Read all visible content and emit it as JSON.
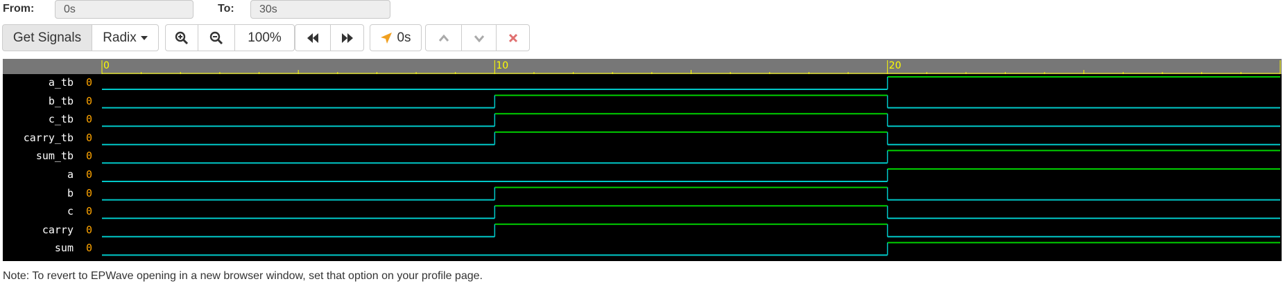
{
  "range": {
    "from_label": "From:",
    "from_value": "0s",
    "to_label": "To:",
    "to_value": "30s"
  },
  "toolbar": {
    "get_signals": "Get Signals",
    "radix": "Radix",
    "zoom": "100%",
    "cursor_time": "0s"
  },
  "icons": {
    "zoom_in": "zoom-in-icon",
    "zoom_out": "zoom-out-icon",
    "rewind": "rewind-icon",
    "fast_forward": "fast-forward-icon",
    "cursor": "location-arrow-icon",
    "up": "chevron-up-icon",
    "down": "chevron-down-icon",
    "close": "close-icon"
  },
  "colors": {
    "ruler_bg": "#777777",
    "ruler_text": "#ffff00",
    "wave_bg": "#000000",
    "low_line": "#00c8c8",
    "high_line": "#00d000",
    "value_text": "#ffa500",
    "name_text": "#ffffff"
  },
  "waveform": {
    "time_start": 0,
    "time_end": 30,
    "major_ticks": [
      "0",
      "10",
      "20"
    ],
    "signals": [
      {
        "name": "a_tb",
        "value": "0",
        "transitions": [
          [
            0,
            0
          ],
          [
            20,
            1
          ]
        ]
      },
      {
        "name": "b_tb",
        "value": "0",
        "transitions": [
          [
            0,
            0
          ],
          [
            10,
            1
          ],
          [
            20,
            0
          ]
        ]
      },
      {
        "name": "c_tb",
        "value": "0",
        "transitions": [
          [
            0,
            0
          ],
          [
            10,
            1
          ],
          [
            20,
            0
          ]
        ]
      },
      {
        "name": "carry_tb",
        "value": "0",
        "transitions": [
          [
            0,
            0
          ],
          [
            10,
            1
          ],
          [
            20,
            0
          ]
        ]
      },
      {
        "name": "sum_tb",
        "value": "0",
        "transitions": [
          [
            0,
            0
          ],
          [
            20,
            1
          ]
        ]
      },
      {
        "name": "a",
        "value": "0",
        "transitions": [
          [
            0,
            0
          ],
          [
            20,
            1
          ]
        ]
      },
      {
        "name": "b",
        "value": "0",
        "transitions": [
          [
            0,
            0
          ],
          [
            10,
            1
          ],
          [
            20,
            0
          ]
        ]
      },
      {
        "name": "c",
        "value": "0",
        "transitions": [
          [
            0,
            0
          ],
          [
            10,
            1
          ],
          [
            20,
            0
          ]
        ]
      },
      {
        "name": "carry",
        "value": "0",
        "transitions": [
          [
            0,
            0
          ],
          [
            10,
            1
          ],
          [
            20,
            0
          ]
        ]
      },
      {
        "name": "sum",
        "value": "0",
        "transitions": [
          [
            0,
            0
          ],
          [
            20,
            1
          ]
        ]
      }
    ]
  },
  "note": "Note: To revert to EPWave opening in a new browser window, set that option on your profile page."
}
